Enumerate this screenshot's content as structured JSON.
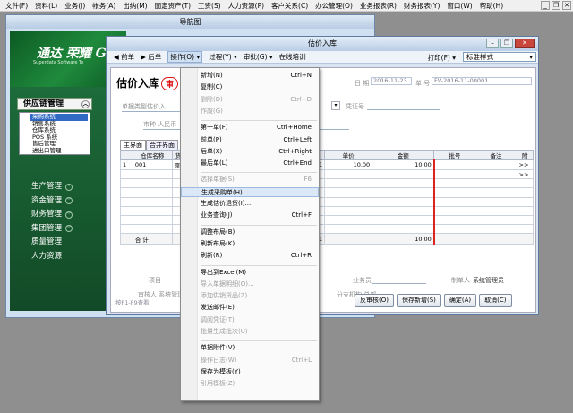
{
  "app_menu": [
    "文件(F)",
    "资料(L)",
    "业务(J)",
    "帐务(A)",
    "出纳(M)",
    "固定资产(T)",
    "工资(S)",
    "人力资源(P)",
    "客户关系(C)",
    "办公管理(O)",
    "业务报表(R)",
    "财务报表(Y)",
    "窗口(W)",
    "帮助(H)"
  ],
  "nav_window": {
    "title": "导航图",
    "banner_logo": "通达 荣耀 G",
    "banner_sub": "Superdata Software Te",
    "group_title": "供应链管理",
    "sub_items": [
      "采购系统",
      "销售系统",
      "仓库系统",
      "POS 系统",
      "售后管理",
      "进出口管理"
    ],
    "categories": [
      "生产管理",
      "资金管理",
      "财务管理",
      "集团管理",
      "质量管理",
      "人力资源"
    ]
  },
  "est_window": {
    "title": "估价入库",
    "toolbar": [
      "前单",
      "后单",
      "操作(O)",
      "过程(Y)",
      "审批(G)",
      "在线培训"
    ],
    "print_label": "打印(F)",
    "style_select": "标准样式",
    "doc_title": "估价入库",
    "status_oval": "审",
    "date_label": "日 期",
    "date_value": "2016-11-23",
    "no_label": "单 号",
    "no_value": "FV-2016-11-00001",
    "field_source": "单据类型估价入",
    "field_voucher": "凭证号",
    "field_currency": "市种 人民币",
    "tabs": [
      "主界面",
      "合并界面"
    ],
    "table": {
      "headers": [
        "",
        "仓库名称",
        "货",
        "",
        "单价",
        "金额",
        "批号",
        "备注",
        "附"
      ],
      "rows": [
        [
          "1",
          "001",
          "原",
          "1",
          "10.00",
          "10.00",
          "",
          "",
          ">>"
        ],
        [
          "",
          "",
          "",
          "",
          "",
          "",
          "",
          "",
          ">>"
        ]
      ],
      "sum_label": "合 计",
      "sum_qty": "1",
      "sum_amount": "10.00"
    },
    "footer": {
      "project": "项目",
      "salesman": "业务员",
      "maker_label": "制单人",
      "maker": "系统管理员",
      "approver": "审核人 系统管理",
      "branch": "分支机构 总部"
    },
    "status_hint": "按F1-F9查看",
    "buttons": [
      "反审核(O)",
      "保存新增(S)",
      "确定(A)",
      "取消(C)"
    ]
  },
  "context_menu": [
    {
      "label": "新增(N)",
      "shortcut": "Ctrl+N",
      "disabled": false
    },
    {
      "label": "复制(C)",
      "shortcut": "",
      "disabled": false
    },
    {
      "label": "删除(D)",
      "shortcut": "Ctrl+D",
      "disabled": true
    },
    {
      "label": "作废(G)",
      "shortcut": "",
      "disabled": true
    },
    {
      "sep": true
    },
    {
      "label": "第一单(F)",
      "shortcut": "Ctrl+Home",
      "disabled": false
    },
    {
      "label": "前单(P)",
      "shortcut": "Ctrl+Left",
      "disabled": false
    },
    {
      "label": "后单(X)",
      "shortcut": "Ctrl+Right",
      "disabled": false
    },
    {
      "label": "最后单(L)",
      "shortcut": "Ctrl+End",
      "disabled": false
    },
    {
      "sep": true
    },
    {
      "label": "选择单据(S)",
      "shortcut": "F6",
      "disabled": true
    },
    {
      "label": "生成采购单(H)...",
      "shortcut": "",
      "disabled": false,
      "highlight": true
    },
    {
      "label": "生成估价退货(I)...",
      "shortcut": "",
      "disabled": false
    },
    {
      "label": "业务查询(J)",
      "shortcut": "Ctrl+F",
      "disabled": false
    },
    {
      "sep": true
    },
    {
      "label": "调整布局(B)",
      "shortcut": "",
      "disabled": false
    },
    {
      "label": "刷新布局(K)",
      "shortcut": "",
      "disabled": false
    },
    {
      "label": "刷新(R)",
      "shortcut": "Ctrl+R",
      "disabled": false
    },
    {
      "sep": true
    },
    {
      "label": "导出到Excel(M)",
      "shortcut": "",
      "disabled": false
    },
    {
      "label": "导入单据明细(O)...",
      "shortcut": "",
      "disabled": true
    },
    {
      "label": "添加供销货品(Z)",
      "shortcut": "",
      "disabled": true
    },
    {
      "label": "发送邮件(E)",
      "shortcut": "",
      "disabled": false
    },
    {
      "label": "调阅凭证(T)",
      "shortcut": "",
      "disabled": true
    },
    {
      "label": "批量生成批次(U)",
      "shortcut": "",
      "disabled": true
    },
    {
      "sep": true
    },
    {
      "label": "单据附件(V)",
      "shortcut": "",
      "disabled": false
    },
    {
      "label": "操作日志(W)",
      "shortcut": "Ctrl+L",
      "disabled": true
    },
    {
      "label": "保存为模板(Y)",
      "shortcut": "",
      "disabled": false
    },
    {
      "label": "引用模板(Z)",
      "shortcut": "",
      "disabled": true
    }
  ]
}
